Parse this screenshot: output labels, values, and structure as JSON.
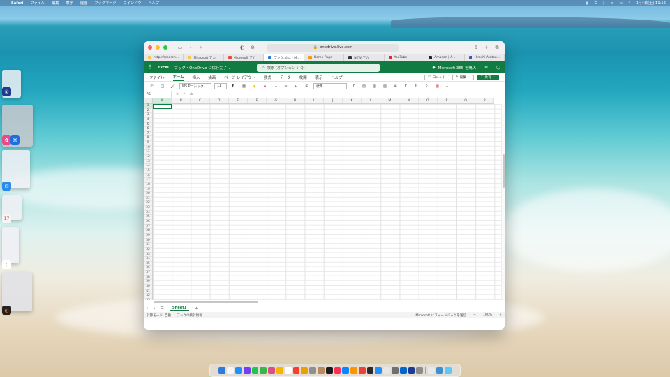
{
  "menubar": {
    "app": "Safari",
    "items": [
      "ファイル",
      "編集",
      "表示",
      "履歴",
      "ブックマーク",
      "ウインドウ",
      "ヘルプ"
    ],
    "datetime": "3月4日(土) 11:16"
  },
  "browser": {
    "address": "onedrive.live.com",
    "tabs": [
      {
        "label": "https://search...",
        "color": "#f2c94c"
      },
      {
        "label": "Microsoft アカ",
        "color": "#f2c94c"
      },
      {
        "label": "Microsoft アカ",
        "color": "#e74c3c"
      },
      {
        "label": "ブック.xlsx - Mi...",
        "color": "#2d7cd6"
      },
      {
        "label": "Home Page",
        "color": "#f39c12"
      },
      {
        "label": "NEW アカ",
        "color": "#333333"
      },
      {
        "label": "YouTube",
        "color": "#e52d27"
      },
      {
        "label": "Amazon | A...",
        "color": "#222222"
      },
      {
        "label": "Hiroshi Atatsu...",
        "color": "#2d5fb4"
      }
    ]
  },
  "excel": {
    "app_name": "Excel",
    "doc_title": "ブック・OneDrive に保存完了 ⌄",
    "search_placeholder": "検索 (オプション + Q)",
    "m365": "Microsoft 365 を購入",
    "ribbon_tabs": [
      "ファイル",
      "ホーム",
      "挿入",
      "描画",
      "ページ レイアウト",
      "数式",
      "データ",
      "校閲",
      "表示",
      "ヘルプ"
    ],
    "selected_tab": "ホーム",
    "comment_btn": "コメント",
    "edit_btn": "編集",
    "share_btn": "共有",
    "font_name": "MS Pゴシック",
    "font_size": "11",
    "number_format": "標準",
    "name_box": "A1",
    "fx": "fx",
    "columns": [
      "A",
      "B",
      "C",
      "D",
      "E",
      "F",
      "G",
      "H",
      "I",
      "J",
      "K",
      "L",
      "M",
      "N",
      "O",
      "P",
      "Q",
      "R"
    ],
    "rows": [
      "1",
      "2",
      "3",
      "4",
      "5",
      "6",
      "7",
      "8",
      "9",
      "10",
      "11",
      "12",
      "13",
      "14",
      "15",
      "16",
      "17",
      "18",
      "19",
      "20",
      "21",
      "22",
      "23",
      "24",
      "25",
      "26",
      "27",
      "28",
      "29",
      "30",
      "31",
      "32",
      "33",
      "34",
      "35",
      "36",
      "37",
      "38",
      "39",
      "40",
      "41",
      "42",
      "43"
    ],
    "sheet": "Sheet1",
    "status_left": "計算モード: 自動",
    "status_left2": "ブックの統計情報",
    "feedback": "Microsoft にフィードバックを送信",
    "zoom": "100%"
  },
  "dock_colors": [
    "#2f7bd6",
    "#f5f5f5",
    "#1e90ff",
    "#7a3cf0",
    "#23c552",
    "#3ab54a",
    "#d94f86",
    "#f7b500",
    "#ffffff",
    "#ff3b30",
    "#e8a200",
    "#8e8e93",
    "#b98a5c",
    "#1c1c1e",
    "#ff2d55",
    "#0a84ff",
    "#ff9500",
    "#ea4335",
    "#2b2b2b",
    "#1e90ff",
    "#e6e6e6",
    "#6e6e73",
    "#0066cc",
    "#1f3a93",
    "#8c8c8c",
    "#e8e8e8",
    "#3e8ed0",
    "#5ac8fa"
  ]
}
